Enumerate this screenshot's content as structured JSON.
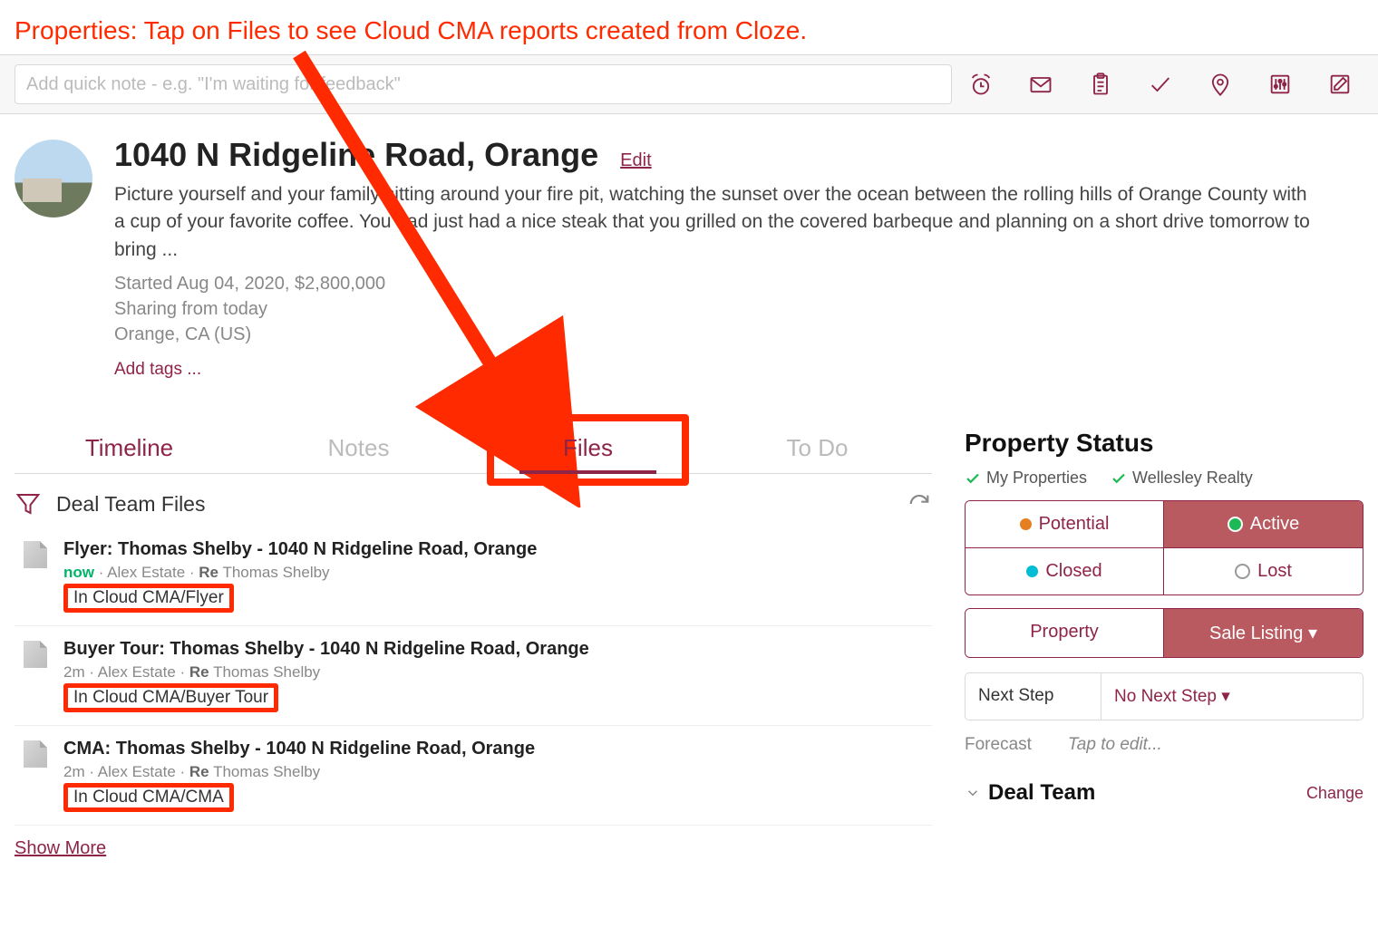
{
  "annotation": "Properties: Tap on Files to see Cloud CMA reports created from Cloze.",
  "note_placeholder": "Add quick note - e.g. \"I'm waiting for feedback\"",
  "toolbar_icons": [
    "reminder-icon",
    "mail-icon",
    "clipboard-icon",
    "check-icon",
    "pin-icon",
    "sliders-icon",
    "compose-icon"
  ],
  "header": {
    "title": "1040 N Ridgeline Road, Orange",
    "edit": "Edit",
    "description": "Picture yourself and your family sitting around your fire pit, watching the sunset over the ocean between the rolling hills of Orange County with a cup of your favorite coffee. You had just had a nice steak that you grilled on the covered barbeque and planning on a short drive tomorrow to bring ...",
    "started": "Started Aug 04, 2020, $2,800,000",
    "sharing": "Sharing from today",
    "location": "Orange, CA (US)",
    "add_tags": "Add tags ..."
  },
  "tabs": [
    "Timeline",
    "Notes",
    "Files",
    "To Do"
  ],
  "files_section": {
    "title": "Deal Team Files",
    "show_more": "Show More",
    "items": [
      {
        "title": "Flyer: Thomas Shelby - 1040 N Ridgeline Road, Orange",
        "time": "now",
        "author": "Alex Estate",
        "re": "Re",
        "contact": "Thomas Shelby",
        "location": "In Cloud CMA/Flyer"
      },
      {
        "title": "Buyer Tour: Thomas Shelby - 1040 N Ridgeline Road, Orange",
        "time": "2m",
        "author": "Alex Estate",
        "re": "Re",
        "contact": "Thomas Shelby",
        "location": "In Cloud CMA/Buyer Tour"
      },
      {
        "title": "CMA: Thomas Shelby - 1040 N Ridgeline Road, Orange",
        "time": "2m",
        "author": "Alex Estate",
        "re": "Re",
        "contact": "Thomas Shelby",
        "location": "In Cloud CMA/CMA"
      }
    ]
  },
  "sidebar": {
    "status_title": "Property Status",
    "checks": [
      "My Properties",
      "Wellesley Realty"
    ],
    "statuses": [
      "Potential",
      "Active",
      "Closed",
      "Lost"
    ],
    "types": [
      "Property",
      "Sale Listing ▾"
    ],
    "next_step_label": "Next Step",
    "next_step_value": "No Next Step ▾",
    "forecast_label": "Forecast",
    "forecast_value": "Tap to edit...",
    "deal_team": "Deal Team",
    "change": "Change"
  }
}
